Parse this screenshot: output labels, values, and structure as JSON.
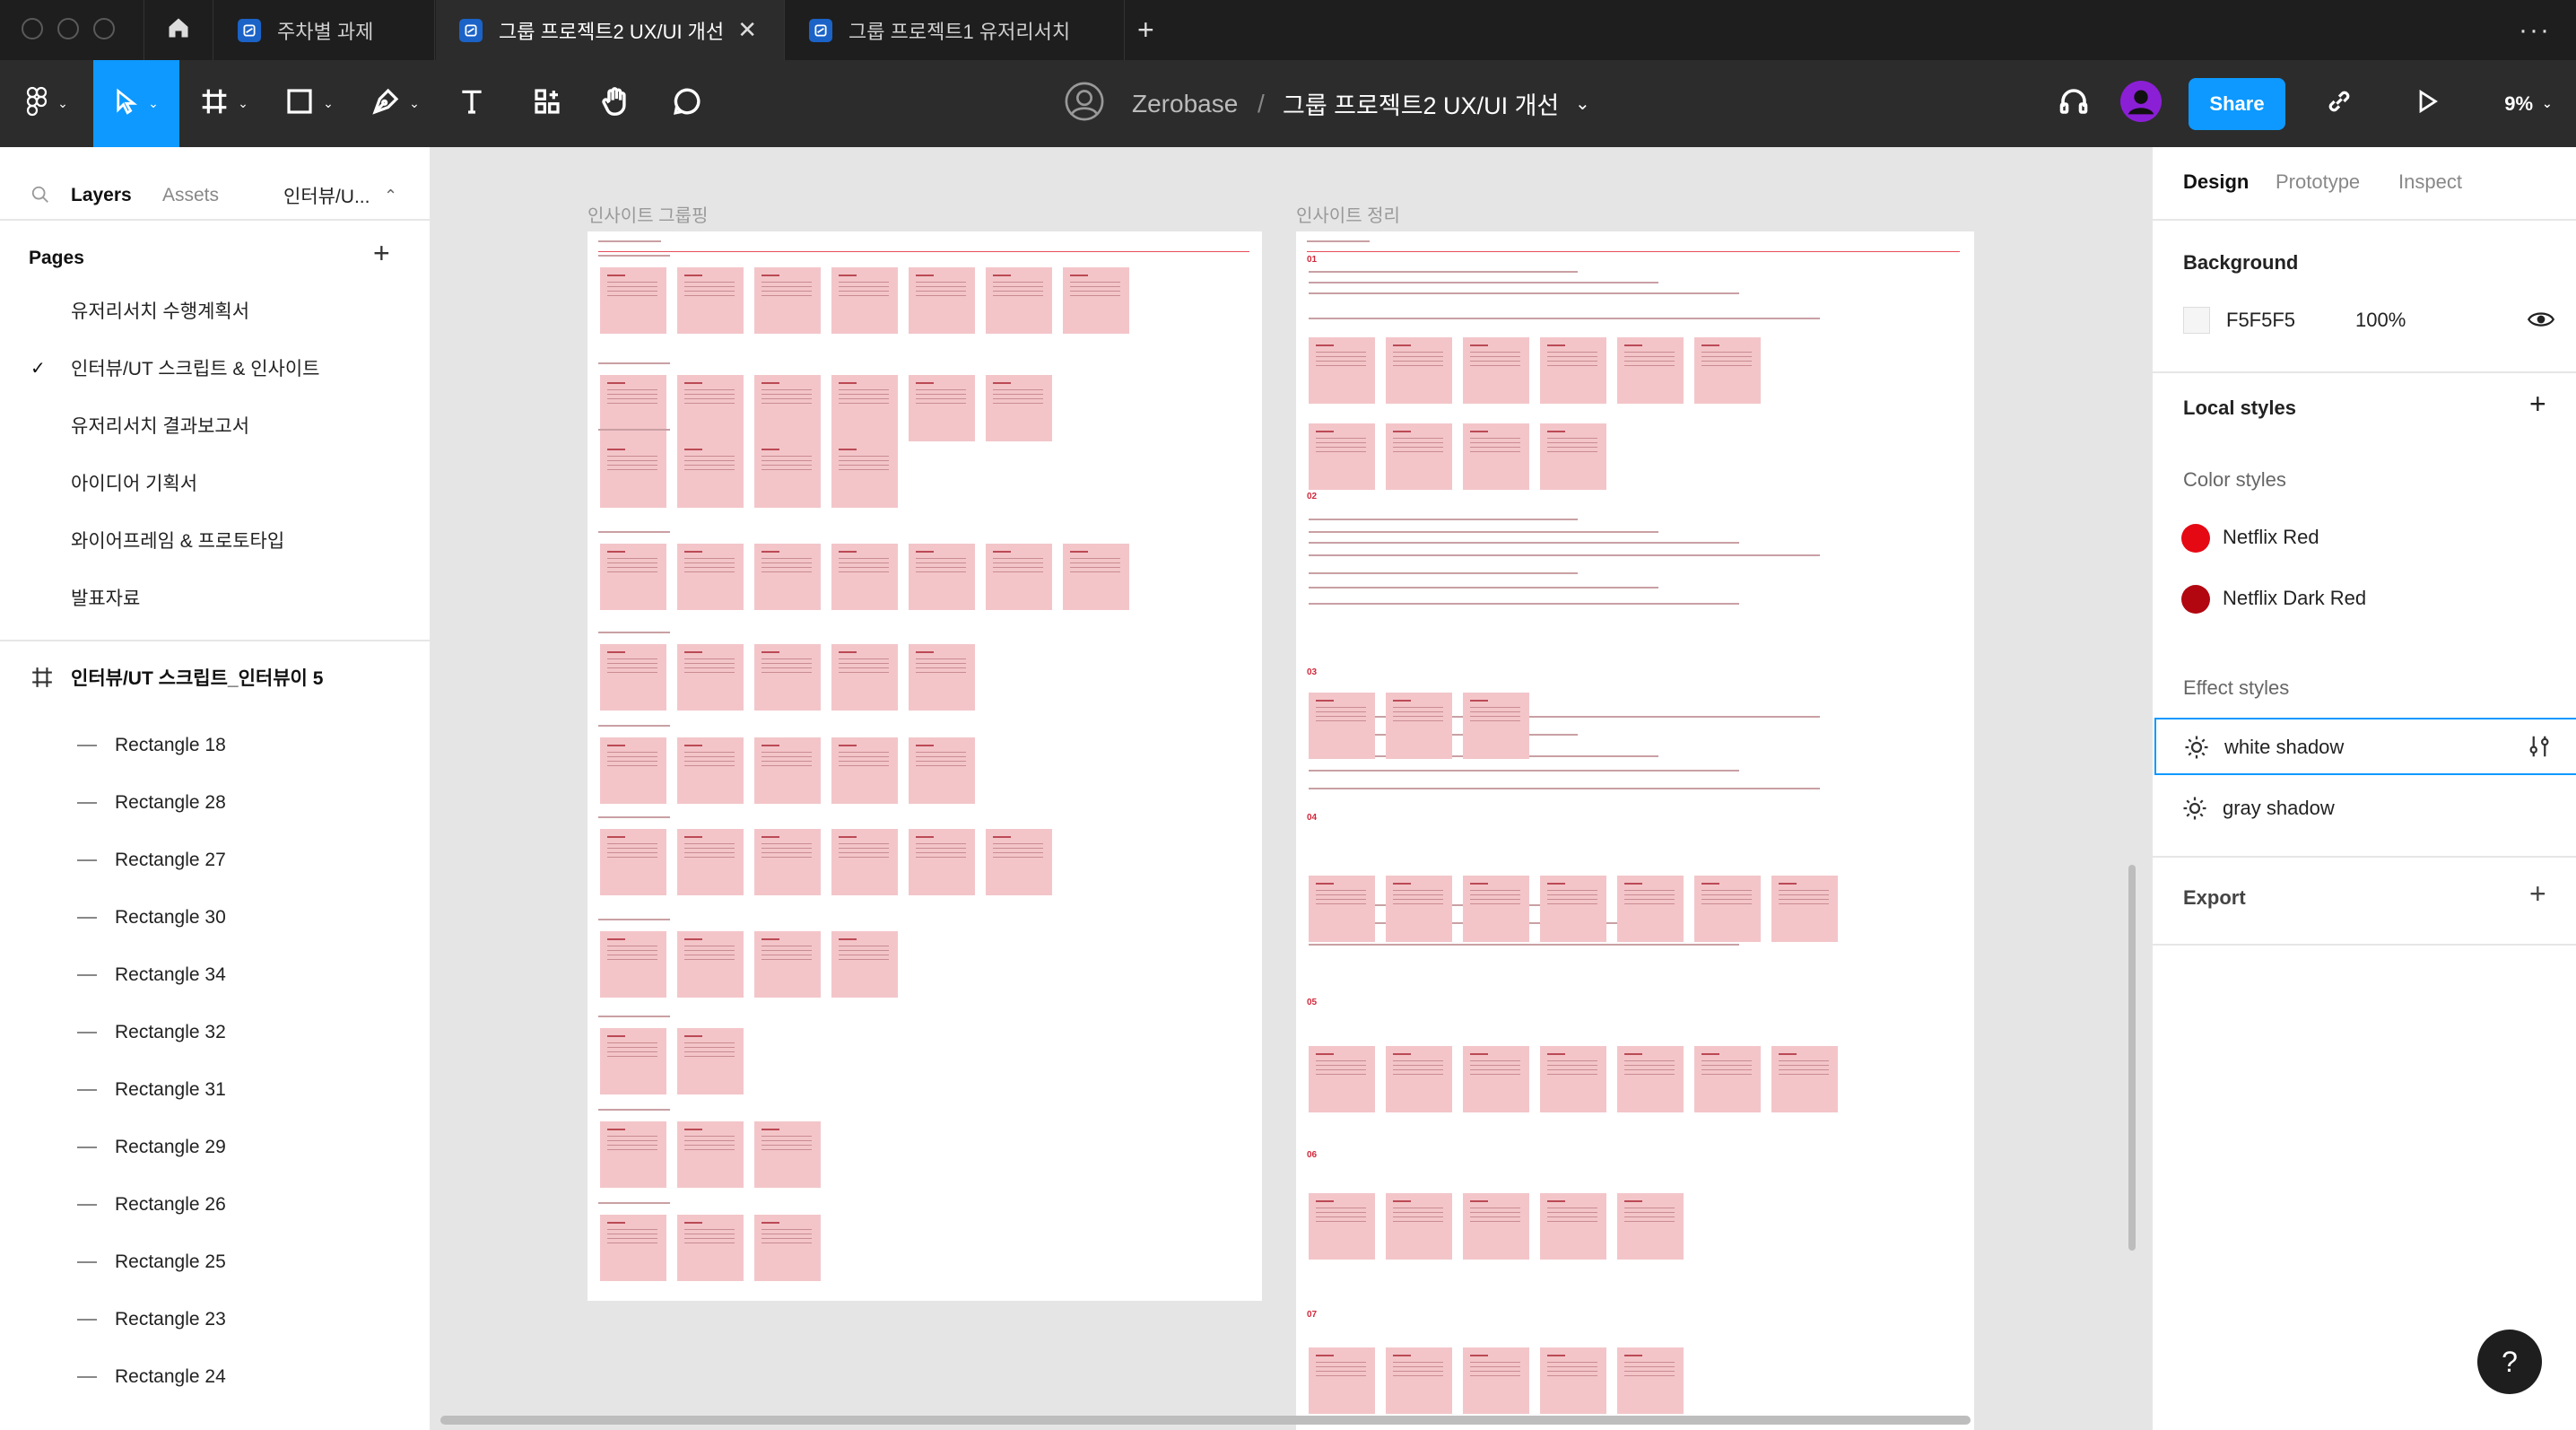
{
  "tabs": [
    {
      "label": "주차별 과제"
    },
    {
      "label": "그룹 프로젝트2 UX/UI 개선"
    },
    {
      "label": "그룹 프로젝트1 유저리서치"
    }
  ],
  "toolbar": {
    "team": "Zerobase",
    "separator": "/",
    "file_name": "그룹 프로젝트2 UX/UI 개선",
    "share_label": "Share",
    "zoom": "9%"
  },
  "left_panel": {
    "tabs": [
      "Layers",
      "Assets"
    ],
    "page_selector": "인터뷰/U...",
    "pages_title": "Pages",
    "pages": [
      {
        "label": "유저리서치 수행계획서",
        "selected": false
      },
      {
        "label": "인터뷰/UT 스크립트 & 인사이트",
        "selected": true
      },
      {
        "label": "유저리서치 결과보고서",
        "selected": false
      },
      {
        "label": "아이디어 기획서",
        "selected": false
      },
      {
        "label": "와이어프레임 & 프로토타입",
        "selected": false
      },
      {
        "label": "발표자료",
        "selected": false
      }
    ],
    "frame_layer": "인터뷰/UT 스크립트_인터뷰이 5",
    "layers": [
      "Rectangle 18",
      "Rectangle 28",
      "Rectangle 27",
      "Rectangle 30",
      "Rectangle 34",
      "Rectangle 32",
      "Rectangle 31",
      "Rectangle 29",
      "Rectangle 26",
      "Rectangle 25",
      "Rectangle 23",
      "Rectangle 24"
    ]
  },
  "canvas": {
    "frame1_label": "인사이트 그룹핑",
    "frame2_label": "인사이트 정리",
    "section_numbers": [
      "01",
      "02",
      "03",
      "04",
      "05",
      "06",
      "07"
    ]
  },
  "right_panel": {
    "tabs": [
      "Design",
      "Prototype",
      "Inspect"
    ],
    "background_title": "Background",
    "background_hex": "F5F5F5",
    "background_opacity": "100%",
    "local_styles_title": "Local styles",
    "color_styles_title": "Color styles",
    "color_styles": [
      {
        "name": "Netflix Red",
        "color": "#e50914"
      },
      {
        "name": "Netflix Dark Red",
        "color": "#b20710"
      }
    ],
    "effect_styles_title": "Effect styles",
    "effect_styles": [
      {
        "name": "white shadow"
      },
      {
        "name": "gray shadow"
      }
    ],
    "export_title": "Export"
  },
  "help_label": "?"
}
